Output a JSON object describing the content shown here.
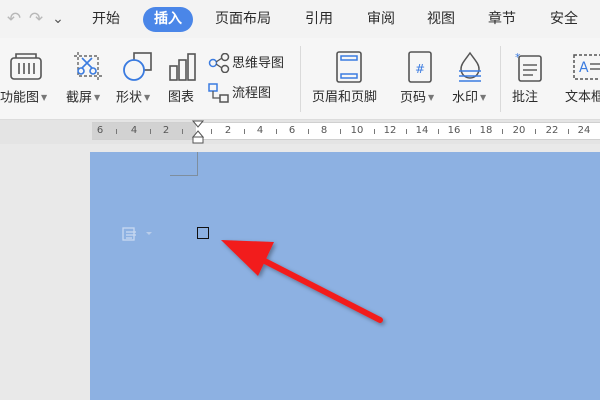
{
  "quick_access": {
    "undo": "↶",
    "redo": "↷",
    "more": "⌄"
  },
  "menu": {
    "items": [
      {
        "label": "开始",
        "active": false
      },
      {
        "label": "插入",
        "active": true
      },
      {
        "label": "页面布局",
        "active": false
      },
      {
        "label": "引用",
        "active": false
      },
      {
        "label": "审阅",
        "active": false
      },
      {
        "label": "视图",
        "active": false
      },
      {
        "label": "章节",
        "active": false
      },
      {
        "label": "安全",
        "active": false
      }
    ]
  },
  "ribbon": {
    "feature_chart": "功能图",
    "screenshot": "截屏",
    "shapes": "形状",
    "chart": "图表",
    "mindmap": "思维导图",
    "flowchart": "流程图",
    "header_footer": "页眉和页脚",
    "page_number": "页码",
    "watermark": "水印",
    "comment": "批注",
    "textbox": "文本框"
  },
  "ruler": {
    "left_labels": [
      "6",
      "4",
      "2"
    ],
    "right_labels": [
      "2",
      "4",
      "6",
      "8",
      "10",
      "12",
      "14",
      "16",
      "18",
      "20",
      "22",
      "24"
    ]
  },
  "colors": {
    "accent": "#4a86e8",
    "page_fill": "#8db1e2",
    "arrow": "#f21c1c"
  }
}
